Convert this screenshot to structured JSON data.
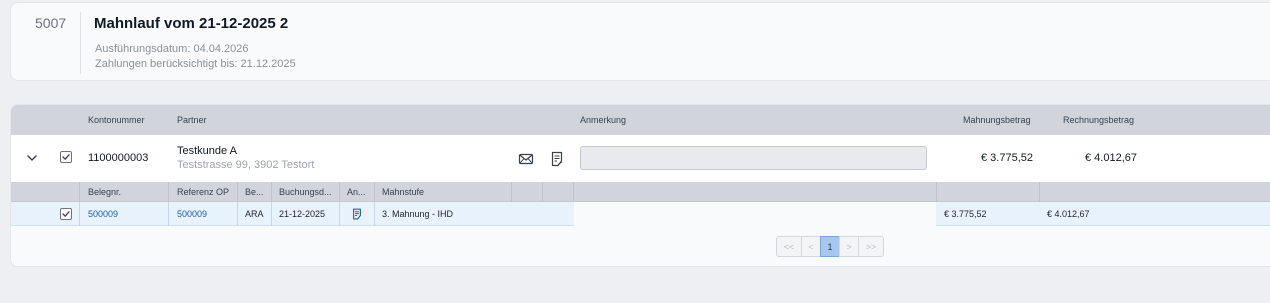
{
  "header": {
    "run_id": "5007",
    "title": "Mahnlauf vom 21-12-2025 2",
    "execution_date": "Ausführungsdatum: 04.04.2026",
    "payments_until": "Zahlungen berücksichtigt bis: 21.12.2025"
  },
  "table": {
    "columns": {
      "account": "Kontonummer",
      "partner": "Partner",
      "remark": "Anmerkung",
      "dunning_amount": "Mahnungsbetrag",
      "invoice_amount": "Rechnungsbetrag"
    },
    "row": {
      "account": "1100000003",
      "partner_name": "Testkunde A",
      "partner_address": "Teststrasse 99, 3902 Testort",
      "remark_value": "",
      "dunning_amount": "€ 3.775,52",
      "invoice_amount": "€ 4.012,67",
      "checked": true,
      "expanded": true
    },
    "sub_columns": {
      "doc_no": "Belegnr.",
      "ref_op": "Referenz OP",
      "be": "Be...",
      "booking_date": "Buchungsd...",
      "an": "An...",
      "dunning_level": "Mahnstufe"
    },
    "detail": {
      "doc_no": "500009",
      "ref_op": "500009",
      "be": "ARA",
      "booking_date": "21-12-2025",
      "dunning_level": "3. Mahnung - IHD",
      "dunning_amount": "€ 3.775,52",
      "invoice_amount": "€ 4.012,67",
      "checked": true
    }
  },
  "pagination": {
    "first": "<<",
    "prev": "<",
    "current": "1",
    "next": ">",
    "last": ">>"
  },
  "icons": {
    "expand": "chevron-down-icon",
    "email": "envelope-icon",
    "document": "document-list-icon",
    "checkbox": "checkbox-checked-icon"
  },
  "colors": {
    "accent": "#1f5fa6",
    "selected_row": "#e8f2fc",
    "active_page": "#a7c8ec",
    "header_band": "#d1d5db"
  }
}
